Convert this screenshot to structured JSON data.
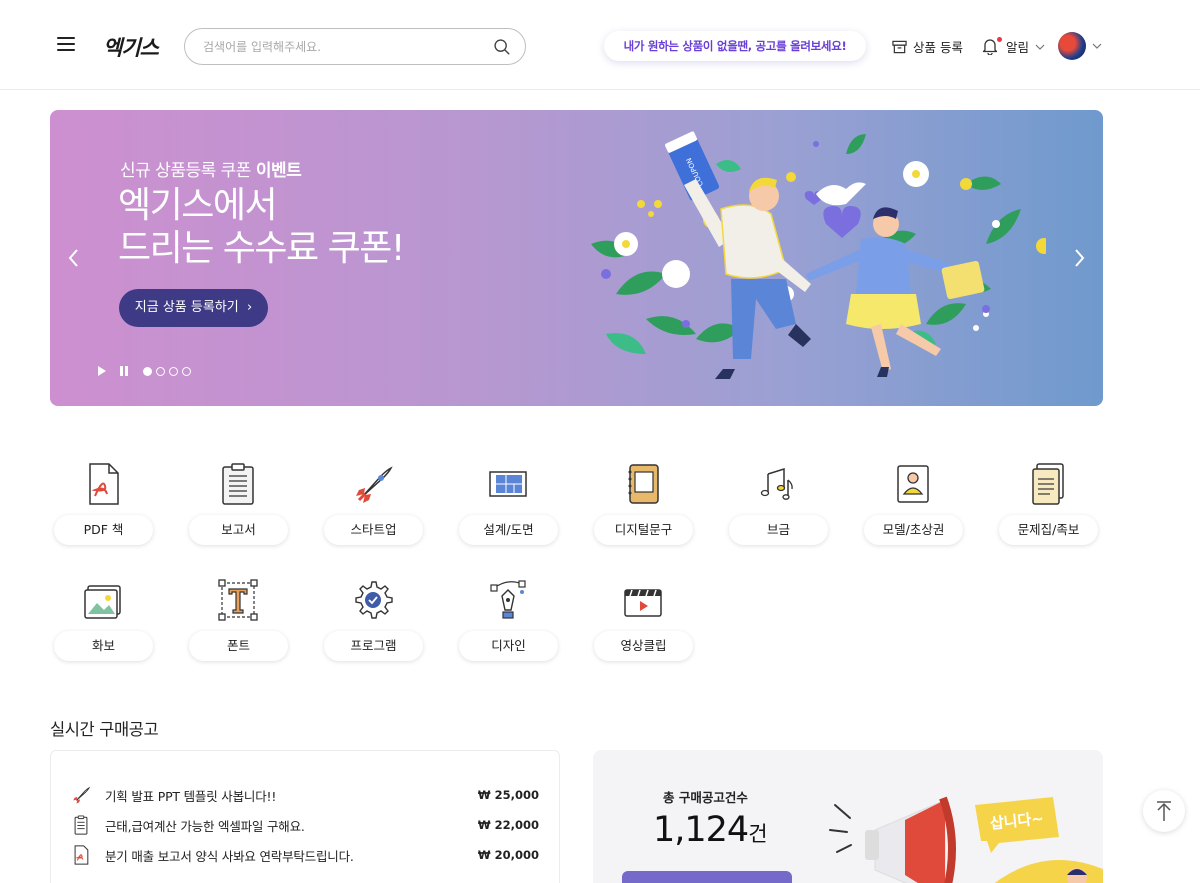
{
  "header": {
    "logo": "엑기스",
    "search_placeholder": "검색어를 입력해주세요.",
    "promo": "내가 원하는 상품이 없을땐, 공고를 올려보세요!",
    "register_label": "상품 등록",
    "alarm_label": "알림"
  },
  "banner": {
    "subtitle_plain": "신규 상품등록 쿠폰 ",
    "subtitle_bold": "이벤트",
    "title_line1": "엑기스에서",
    "title_line2": "드리는 수수료 쿠폰!",
    "cta": "지금 상품 등록하기",
    "coupon_text": "COUPON",
    "slide_count": 4,
    "active_slide": 1
  },
  "categories": [
    {
      "label": "PDF 책",
      "icon": "pdf-icon"
    },
    {
      "label": "보고서",
      "icon": "report-icon"
    },
    {
      "label": "스타트업",
      "icon": "rocket-icon"
    },
    {
      "label": "설계/도면",
      "icon": "blueprint-icon"
    },
    {
      "label": "디지털문구",
      "icon": "planner-icon"
    },
    {
      "label": "브금",
      "icon": "music-icon"
    },
    {
      "label": "모델/초상권",
      "icon": "portrait-icon"
    },
    {
      "label": "문제집/족보",
      "icon": "documents-icon"
    },
    {
      "label": "화보",
      "icon": "image-icon"
    },
    {
      "label": "폰트",
      "icon": "font-icon"
    },
    {
      "label": "프로그램",
      "icon": "gear-icon"
    },
    {
      "label": "디자인",
      "icon": "pen-tool-icon"
    },
    {
      "label": "영상클립",
      "icon": "video-icon"
    }
  ],
  "realtime": {
    "title": "실시간 구매공고",
    "requests": [
      {
        "title": "기획 발표 PPT 템플릿 사봅니다!!",
        "price": "₩ 25,000",
        "icon": "rocket-icon"
      },
      {
        "title": "근태,급여계산 가능한 엑셀파일 구해요.",
        "price": "₩ 22,000",
        "icon": "report-icon"
      },
      {
        "title": "분기 매출 보고서 양식 사봐요 연락부탁드립니다.",
        "price": "₩ 20,000",
        "icon": "pdf-icon"
      }
    ]
  },
  "stats": {
    "label": "총 구매공고건수",
    "value": "1,124",
    "unit": "건",
    "sign_text": "삽니다~"
  },
  "colors": {
    "accent": "#3f3a86",
    "promo_text": "#6a3fd8",
    "button_purple": "#7569c9",
    "icon_red": "#e04a3a"
  }
}
